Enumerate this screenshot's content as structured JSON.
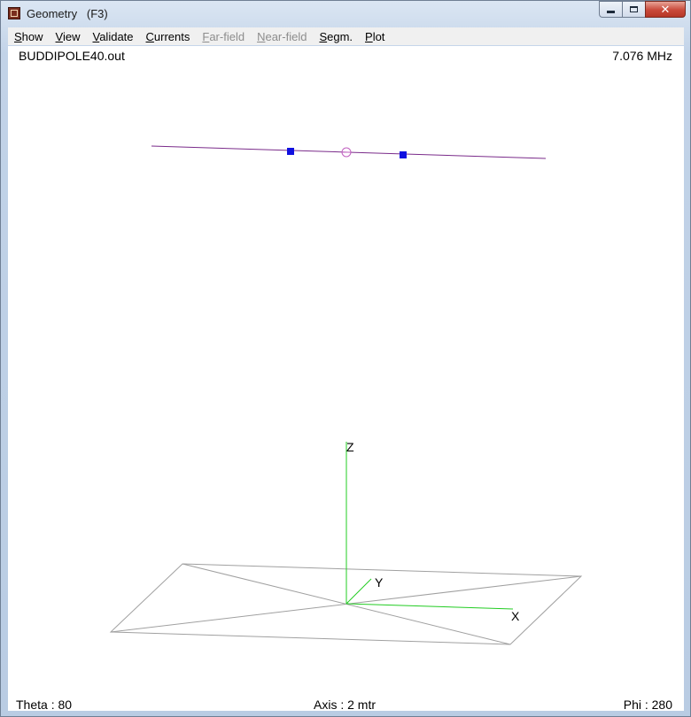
{
  "window": {
    "title": "Geometry   (F3)",
    "minimize_icon": "minimize-icon",
    "maximize_icon": "maximize-icon",
    "close_icon": "close-icon"
  },
  "menu": [
    {
      "label": "Show",
      "enabled": true
    },
    {
      "label": "View",
      "enabled": true
    },
    {
      "label": "Validate",
      "enabled": true
    },
    {
      "label": "Currents",
      "enabled": true
    },
    {
      "label": "Far-field",
      "enabled": false
    },
    {
      "label": "Near-field",
      "enabled": false
    },
    {
      "label": "Segm.",
      "enabled": true
    },
    {
      "label": "Plot",
      "enabled": true
    }
  ],
  "view": {
    "file": "BUDDIPOLE40.out",
    "frequency": "7.076 MHz",
    "theta": "Theta : 80",
    "axis": "Axis : 2 mtr",
    "phi": "Phi : 280",
    "axis_labels": {
      "x": "X",
      "y": "Y",
      "z": "Z"
    },
    "colors": {
      "wire": "#7a2b8a",
      "load_marker": "#1010e0",
      "source_marker": "#c060c0",
      "axes": "#22cc22",
      "ground_plane": "#a0a0a0"
    }
  }
}
